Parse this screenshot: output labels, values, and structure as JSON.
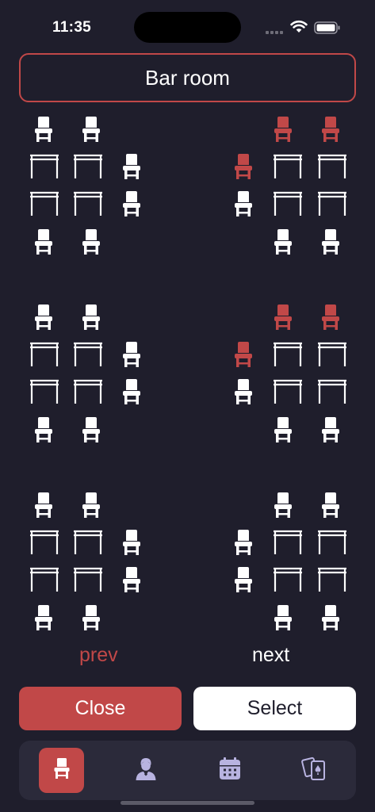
{
  "status_bar": {
    "time": "11:35"
  },
  "room": {
    "title": "Bar room"
  },
  "seating": {
    "blocks": [
      {
        "side": "left",
        "row": 0,
        "reserved_seats": []
      },
      {
        "side": "right",
        "row": 0,
        "reserved_seats": [
          "top-left",
          "top-right",
          "side-top"
        ]
      },
      {
        "side": "left",
        "row": 1,
        "reserved_seats": []
      },
      {
        "side": "right",
        "row": 1,
        "reserved_seats": [
          "top-left",
          "top-right",
          "side-top"
        ]
      },
      {
        "side": "left",
        "row": 2,
        "reserved_seats": []
      },
      {
        "side": "right",
        "row": 2,
        "reserved_seats": []
      }
    ]
  },
  "pager": {
    "prev_label": "prev",
    "next_label": "next"
  },
  "actions": {
    "close_label": "Close",
    "select_label": "Select"
  },
  "tab_bar": {
    "tabs": [
      {
        "icon": "chair-icon",
        "active": true
      },
      {
        "icon": "waiter-icon",
        "active": false
      },
      {
        "icon": "calendar-icon",
        "active": false
      },
      {
        "icon": "playing-cards-icon",
        "active": false
      }
    ]
  },
  "colors": {
    "background": "#1f1e2c",
    "accent": "#c14848",
    "seat": "#ffffff",
    "tab_bar": "#2b2a3a"
  }
}
